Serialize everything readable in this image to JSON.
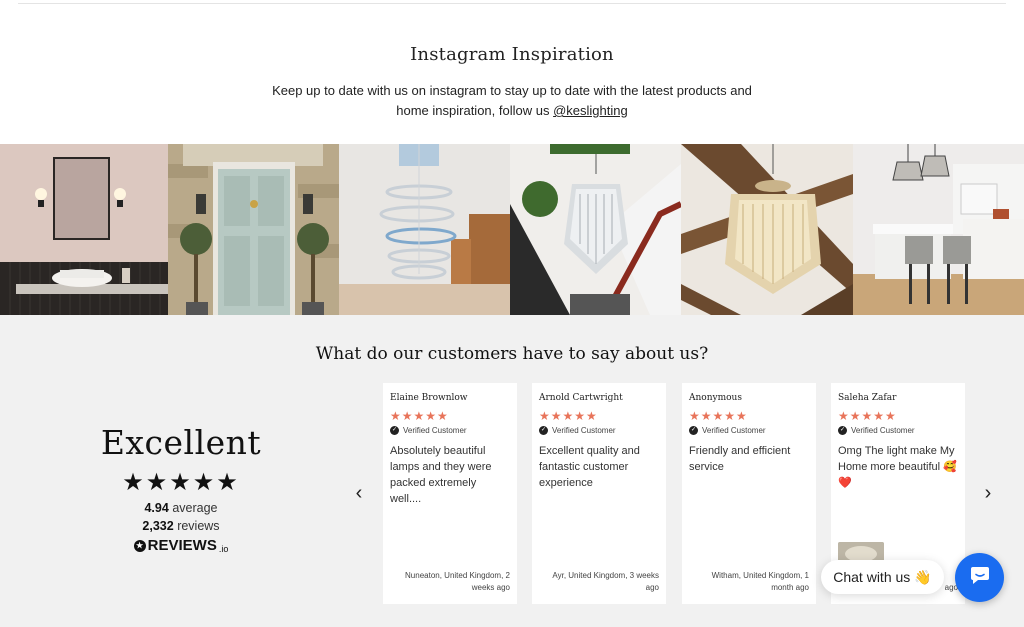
{
  "instagram": {
    "title": "Instagram Inspiration",
    "desc_text": "Keep up to date with us on instagram to stay up to date with the latest products and home inspiration, follow us",
    "handle": "@keslighting"
  },
  "gallery": {
    "tiles": [
      "bathroom-wall-lights",
      "front-door",
      "ring-chandelier",
      "crystal-chandelier-stairs",
      "crystal-chandelier-beams",
      "kitchen-pendants"
    ]
  },
  "reviews": {
    "heading": "What do our customers have to say about us?",
    "summary": {
      "rating_word": "Excellent",
      "stars": "★★★★★",
      "average_value": "4.94",
      "average_label": "average",
      "count_value": "2,332",
      "count_label": "reviews",
      "brand": "REVIEWS",
      "brand_suffix": ".io"
    },
    "prev_arrow": "‹",
    "next_arrow": "›",
    "cards": [
      {
        "name": "Elaine Brownlow",
        "stars": "★★★★★",
        "verified": "Verified Customer",
        "text": "Absolutely beautiful lamps and they were packed extremely well....",
        "location": "Nuneaton, United Kingdom, 2 weeks ago"
      },
      {
        "name": "Arnold Cartwright",
        "stars": "★★★★★",
        "verified": "Verified Customer",
        "text": "Excellent quality and fantastic customer experience",
        "location": "Ayr, United Kingdom, 3 weeks ago"
      },
      {
        "name": "Anonymous",
        "stars": "★★★★★",
        "verified": "Verified Customer",
        "text": "Friendly and efficient service",
        "location": "Witham, United Kingdom, 1 month ago"
      },
      {
        "name": "Saleha Zafar",
        "stars": "★★★★★",
        "verified": "Verified Customer",
        "text": "Omg The light make My Home more beautiful 🥰❤️",
        "location": "ago"
      }
    ]
  },
  "chat": {
    "label": "Chat with us",
    "emoji": "👋"
  },
  "colors": {
    "star_accent": "#e8745a",
    "chat_blue": "#1a6cf0",
    "section_bg": "#f1f1f1"
  }
}
